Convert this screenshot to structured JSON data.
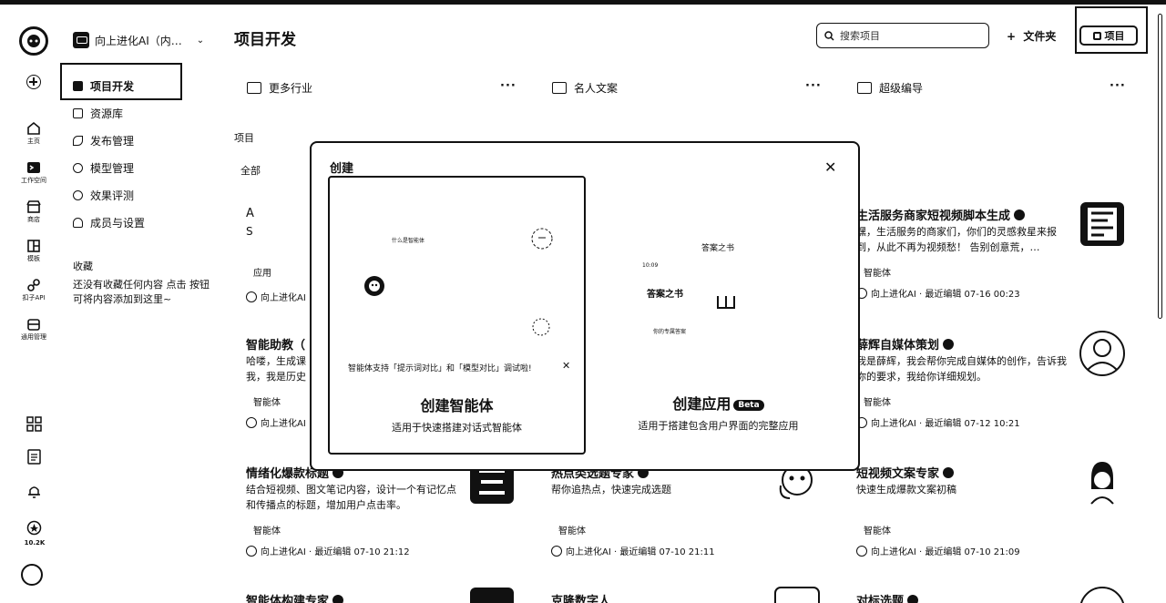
{
  "rail": {
    "items": [
      {
        "label": "主页",
        "icon": "home-icon"
      },
      {
        "label": "工作空间",
        "icon": "workspace-icon"
      },
      {
        "label": "商店",
        "icon": "store-icon"
      },
      {
        "label": "模板",
        "icon": "template-icon"
      },
      {
        "label": "扣子API",
        "icon": "api-icon"
      },
      {
        "label": "通用管理",
        "icon": "manage-icon"
      }
    ],
    "count": "10.2K"
  },
  "workspace": {
    "name": "向上进化AI（内…"
  },
  "nav": {
    "items": [
      "项目开发",
      "资源库",
      "发布管理",
      "模型管理",
      "效果评测",
      "成员与设置"
    ],
    "favorites_title": "收藏",
    "favorites_empty": "还没有收藏任何内容 点击    按钮可将内容添加到这里~"
  },
  "header": {
    "title": "项目开发",
    "search_placeholder": "搜索项目",
    "folder_button": "文件夹",
    "project_button": "项目"
  },
  "folders": [
    "更多行业",
    "名人文案",
    "超级编导"
  ],
  "section_label": "项目",
  "filter_label": "全部",
  "card_a": {
    "title": "A",
    "title2": "S",
    "type": "应用",
    "owner": "向上进化AI"
  },
  "cards": [
    {
      "title": "生活服务商家短视频脚本生成",
      "desc": "嘿，生活服务的商家们，你们的灵感救星来报到，从此不再为视频愁！ 告别创意荒，…",
      "type": "智能体",
      "footer": "向上进化AI · 最近编辑 07-16 00:23"
    },
    {
      "title": "智能助教（",
      "desc": "哈喽，生成课 我，我是历史",
      "type": "智能体",
      "footer": "向上进化AI"
    },
    {
      "title": "薛辉自媒体策划",
      "desc": "我是薛辉，我会帮你完成自媒体的创作，告诉我你的要求，我给你详细规划。",
      "type": "智能体",
      "footer": "向上进化AI · 最近编辑 07-12 10:21"
    },
    {
      "title": "情绪化爆款标题",
      "desc": "结合短视频、图文笔记内容，设计一个有记忆点和传播点的标题，增加用户点击率。",
      "type": "智能体",
      "footer": "向上进化AI · 最近编辑 07-10 21:12"
    },
    {
      "title": "热点类选题专家",
      "desc": "帮你追热点，快速完成选题",
      "type": "智能体",
      "footer": "向上进化AI · 最近编辑 07-10 21:11"
    },
    {
      "title": "短视频文案专家",
      "desc": "快速生成爆款文案初稿",
      "type": "智能体",
      "footer": "向上进化AI · 最近编辑 07-10 21:09"
    },
    {
      "title": "智能体构建专家",
      "desc": "",
      "type": "",
      "footer": ""
    },
    {
      "title": "克隆数字人",
      "desc": "",
      "type": "",
      "footer": ""
    },
    {
      "title": "对标选题",
      "desc": "",
      "type": "",
      "footer": ""
    }
  ],
  "modal": {
    "title": "创建",
    "agent": {
      "title": "创建智能体",
      "desc": "适用于快速搭建对话式智能体",
      "tip": "智能体支持「提示词对比」和「模型对比」调试啦!",
      "preview_text": "什么是智能体"
    },
    "app": {
      "title": "创建应用",
      "badge": "Beta",
      "desc": "适用于搭建包含用户界面的完整应用",
      "preview_title": "答案之书",
      "preview_time": "10:09",
      "preview_heading": "答案之书",
      "preview_sub": "你的专属答案"
    }
  }
}
